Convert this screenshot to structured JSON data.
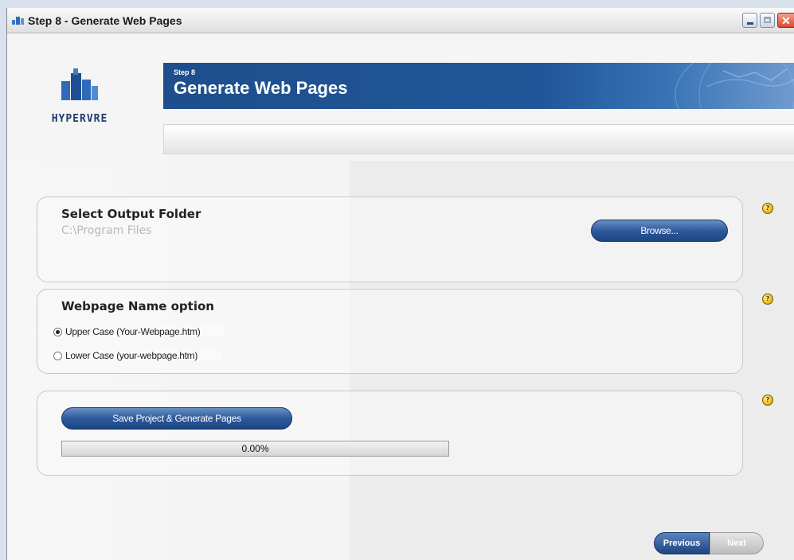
{
  "window": {
    "title": "Step 8 - Generate Web Pages",
    "minimize_icon": "minimize-icon",
    "maximize_icon": "maximize-icon",
    "close_icon": "close-icon"
  },
  "header": {
    "logo_text": "HYPERVRE",
    "step_label": "Step 8",
    "title": "Generate Web Pages",
    "banner_color": "#1e4e8c"
  },
  "output_folder": {
    "title": "Select Output Folder",
    "path": "C:\\Program Files",
    "browse_label": "Browse..."
  },
  "webpage_name": {
    "title": "Webpage Name option",
    "options": [
      {
        "label": "Upper Case (Your-Webpage.htm)",
        "selected": true
      },
      {
        "label": "Lower Case (your-webpage.htm)",
        "selected": false
      }
    ]
  },
  "generate": {
    "button_label": "Save Project & Generate Pages",
    "progress_text": "0.00%",
    "progress_value": 0
  },
  "help_icon": "?",
  "nav": {
    "previous_label": "Previous",
    "next_label": "Next"
  }
}
